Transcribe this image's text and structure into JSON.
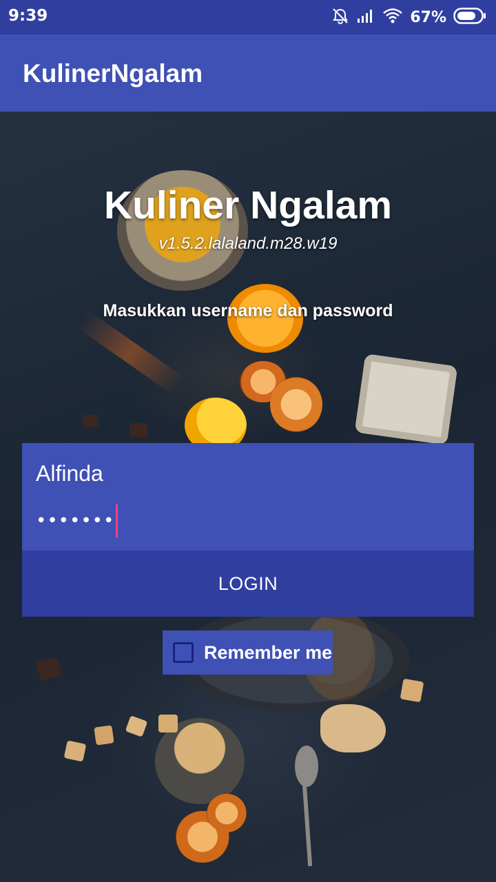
{
  "status_bar": {
    "time": "9:39",
    "battery_percent": "67%",
    "icons": [
      "alarm-off-icon",
      "signal-icon",
      "wifi-icon",
      "battery-icon"
    ]
  },
  "app_bar": {
    "title": "KulinerNgalam"
  },
  "login": {
    "title": "Kuliner Ngalam",
    "version": "v1.5.2.lalaland.m28.w19",
    "instruction": "Masukkan username dan password",
    "username_value": "Alfinda",
    "password_mask": "•••••••",
    "login_label": "LOGIN",
    "remember_label": "Remember me",
    "remember_checked": false
  },
  "colors": {
    "primary": "#3f51b5",
    "primary_dark": "#303f9f",
    "accent": "#ff4081"
  }
}
